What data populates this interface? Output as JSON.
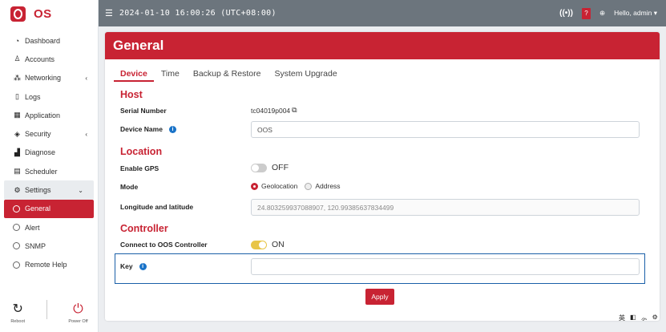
{
  "brand": {
    "name": "OS"
  },
  "sidebar": {
    "items": [
      {
        "label": "Dashboard",
        "icon": "dashboard-icon"
      },
      {
        "label": "Accounts",
        "icon": "user-icon"
      },
      {
        "label": "Networking",
        "icon": "antenna-icon"
      },
      {
        "label": "Logs",
        "icon": "file-icon"
      },
      {
        "label": "Application",
        "icon": "grid-icon"
      },
      {
        "label": "Security",
        "icon": "shield-icon"
      },
      {
        "label": "Diagnose",
        "icon": "chart-icon"
      },
      {
        "label": "Scheduler",
        "icon": "calendar-icon"
      },
      {
        "label": "Settings",
        "icon": "gear-icon"
      },
      {
        "label": "General",
        "icon": "circle-icon"
      },
      {
        "label": "Alert",
        "icon": "circle-icon"
      },
      {
        "label": "SNMP",
        "icon": "circle-icon"
      },
      {
        "label": "Remote Help",
        "icon": "circle-icon"
      }
    ],
    "footer": {
      "reboot": "Reboot",
      "power_off": "Power Off"
    }
  },
  "topbar": {
    "datetime": "2024-01-10 16:00:26 (UTC+08:00)",
    "user": "Hello, admin"
  },
  "page": {
    "title": "General",
    "tabs": [
      "Device",
      "Time",
      "Backup & Restore",
      "System Upgrade"
    ],
    "active_tab": "Device"
  },
  "host": {
    "title": "Host",
    "serial_label": "Serial Number",
    "serial_value": "tc04019p004",
    "device_name_label": "Device Name",
    "device_name_value": "OOS"
  },
  "location": {
    "title": "Location",
    "gps_label": "Enable GPS",
    "gps_state": "OFF",
    "mode_label": "Mode",
    "mode_options": [
      "Geolocation",
      "Address"
    ],
    "mode_selected": "Geolocation",
    "lnglat_label": "Longitude and latitude",
    "lnglat_value": "24.803259937088907, 120.99385637834499"
  },
  "controller": {
    "title": "Controller",
    "connect_label": "Connect to OOS Controller",
    "connect_state": "ON",
    "key_label": "Key",
    "key_value": ""
  },
  "actions": {
    "apply": "Apply"
  },
  "ime": {
    "lang": "英"
  },
  "colors": {
    "accent": "#c82333",
    "topbar": "#6c757d",
    "toggle_on": "#e8c547",
    "info": "#1a73c8"
  }
}
